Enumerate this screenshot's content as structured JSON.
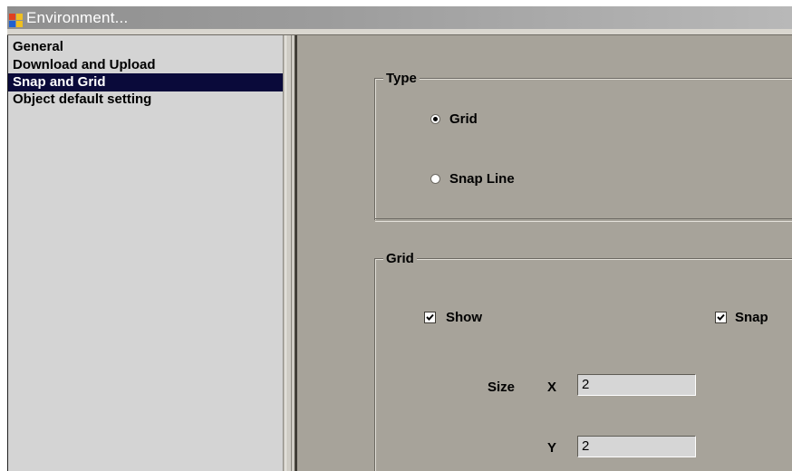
{
  "window": {
    "title": "Environment...",
    "icon": "application-icon"
  },
  "nav": {
    "items": [
      {
        "label": "General",
        "selected": false
      },
      {
        "label": "Download and Upload",
        "selected": false
      },
      {
        "label": "Snap and Grid",
        "selected": true
      },
      {
        "label": "Object default setting",
        "selected": false
      }
    ]
  },
  "type_group": {
    "label": "Type",
    "options": [
      {
        "label": "Grid",
        "checked": true
      },
      {
        "label": "Snap Line",
        "checked": false
      }
    ]
  },
  "grid_group": {
    "label": "Grid",
    "show": {
      "label": "Show",
      "checked": true
    },
    "snap": {
      "label": "Snap",
      "checked": true
    },
    "size_label": "Size",
    "x_label": "X",
    "x_value": "2",
    "y_label": "Y",
    "y_value": "2"
  },
  "colors": {
    "panel": "#a7a39a",
    "nav_background": "#d4d4d4",
    "selection": "#0a0a3a",
    "title_gradient": "#9c9c9c"
  }
}
